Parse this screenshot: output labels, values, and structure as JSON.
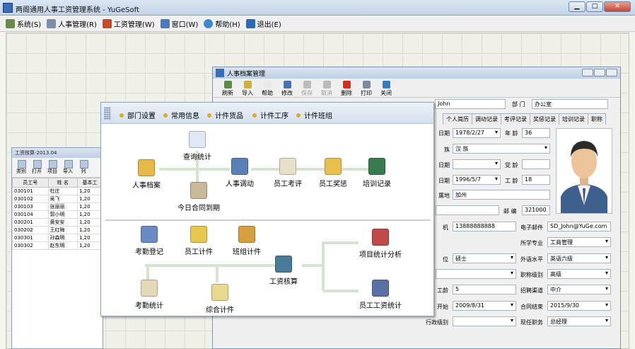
{
  "app": {
    "title": "两阁通用人事工资管理系统 - YuGeSoft"
  },
  "window_buttons": {
    "minimize": "▁",
    "restore": "□",
    "close": "✕"
  },
  "menu": [
    {
      "label": "系统(S)",
      "icon": "system-icon"
    },
    {
      "label": "人事管理(R)",
      "icon": "personnel-icon"
    },
    {
      "label": "工资管理(W)",
      "icon": "salary-icon"
    },
    {
      "label": "窗口(W)",
      "icon": "window-icon"
    },
    {
      "label": "帮助(H)",
      "icon": "help-icon"
    },
    {
      "label": "退出(E)",
      "icon": "exit-icon"
    }
  ],
  "salary_window": {
    "title": "工资核算-2013.04",
    "toolbar": [
      "类别",
      "打开",
      "项目",
      "导入",
      "列"
    ],
    "columns": [
      "员工号",
      "姓 名",
      "基本工"
    ],
    "rows": [
      {
        "id": "030101",
        "name": "杜庄",
        "base": "1,20"
      },
      {
        "id": "030102",
        "name": "吴飞",
        "base": "1,20"
      },
      {
        "id": "030103",
        "name": "张丽丽",
        "base": "1,20"
      },
      {
        "id": "030104",
        "name": "郭小明",
        "base": "1,20"
      },
      {
        "id": "030201",
        "name": "黄安安",
        "base": "1,20"
      },
      {
        "id": "030202",
        "name": "王红梅",
        "base": "1,20"
      },
      {
        "id": "030301",
        "name": "孙森明",
        "base": "1,20"
      },
      {
        "id": "030302",
        "name": "赵东明",
        "base": "1,20"
      }
    ]
  },
  "personnel_window": {
    "title": "人事档案管理",
    "toolbar": [
      "刷新",
      "导入",
      "帮助",
      "修改",
      "保存",
      "取消",
      "删除",
      "打印",
      "关闭"
    ],
    "name_value": "John",
    "dept_label": "部 门",
    "dept_value": "办公室",
    "tabs": [
      "个人简历",
      "调动记录",
      "考评记录",
      "奖惩记录",
      "培训记录",
      "职称"
    ],
    "fields": {
      "birth_label": "日期",
      "birth_value": "1978/2/27",
      "age_label": "年 龄",
      "age_value": "36",
      "nation_label": "族",
      "nation_value": "汉 族",
      "join_label": "日期",
      "party_label": "党 龄",
      "work_label": "日期",
      "work_value": "1996/5/7",
      "seniority_label": "工 龄",
      "seniority_value": "18",
      "origin_label": "属地",
      "origin_value": "加州",
      "zip_label": "邮 编",
      "zip_value": "321000",
      "mobile_label": "机",
      "mobile_value": "13888888888",
      "email_label": "电子邮件",
      "email_value": "SD_John@YuGe.com",
      "major_label": "所学专业",
      "major_value": "工商管理",
      "degree_label": "位",
      "degree_value": "硕士",
      "lang_label": "外语水平",
      "lang_value": "英语六级",
      "title_label": "职称级别",
      "title_value": "高级",
      "co_age_label": "工龄",
      "co_age_value": "5",
      "recruit_label": "招聘渠道",
      "recruit_value": "中介",
      "start_label": "开始",
      "start_value": "2009/8/31",
      "end_label": "合同结束",
      "end_value": "2015/9/30",
      "admin_label": "行政级别",
      "position_label": "现任职务",
      "position_value": "总经理"
    }
  },
  "nav_panel": {
    "tabs": [
      "部门设置",
      "常用信息",
      "计件货品",
      "计件工序",
      "计件班组"
    ],
    "top_links": [
      {
        "label": "查询统计",
        "icon": "query-icon"
      },
      {
        "label": "人事档案",
        "icon": "archive-icon"
      },
      {
        "label": "今日合同到期",
        "icon": "contract-icon"
      },
      {
        "label": "人事调动",
        "icon": "transfer-icon"
      },
      {
        "label": "员工考评",
        "icon": "evaluation-icon"
      },
      {
        "label": "员工奖惩",
        "icon": "reward-icon"
      },
      {
        "label": "培训记录",
        "icon": "training-icon"
      }
    ],
    "bottom_links": [
      {
        "label": "考勤登记",
        "icon": "attendance-icon"
      },
      {
        "label": "员工计件",
        "icon": "piecework-icon"
      },
      {
        "label": "班组计件",
        "icon": "team-piece-icon"
      },
      {
        "label": "考勤统计",
        "icon": "attendance-stats-icon"
      },
      {
        "label": "综合计件",
        "icon": "combined-piece-icon"
      },
      {
        "label": "工资核算",
        "icon": "payroll-icon"
      },
      {
        "label": "项目统计分析",
        "icon": "project-stats-icon"
      },
      {
        "label": "员工工资统计",
        "icon": "salary-stats-icon"
      }
    ]
  },
  "colors": {
    "accent": "#3a6db5",
    "tab_dot": "#e0a82c",
    "flow_line": "#d6e5d0"
  }
}
